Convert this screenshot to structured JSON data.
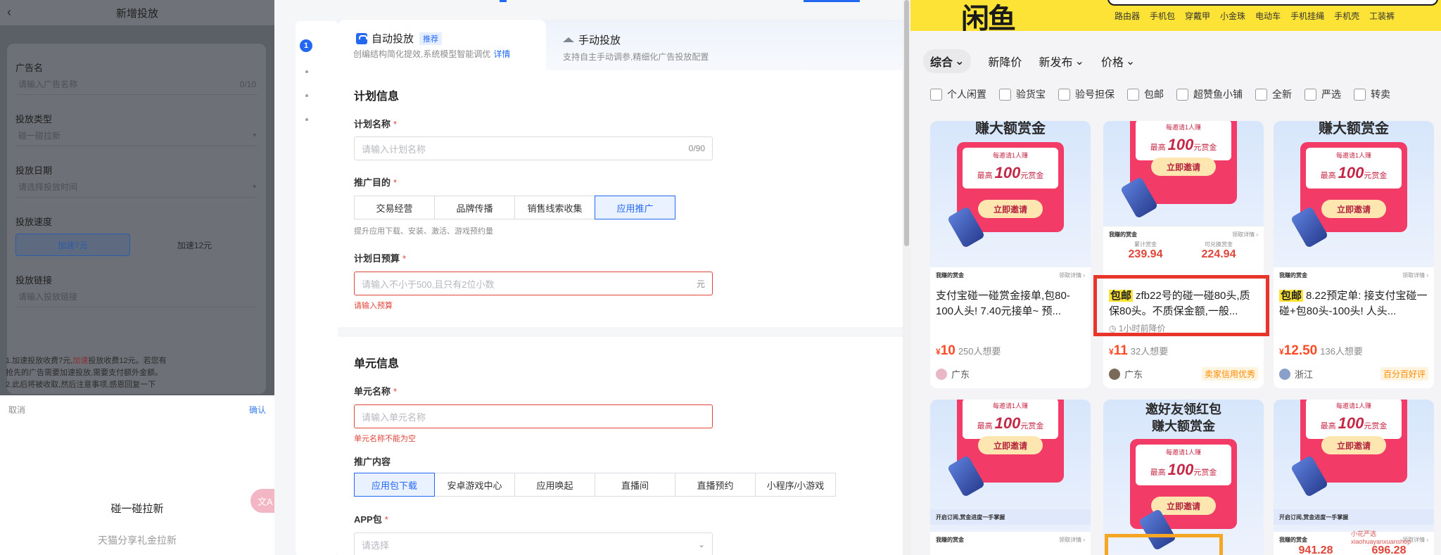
{
  "left": {
    "nav_title": "新增投放",
    "back_icon": "‹",
    "fields": [
      {
        "label": "广告名",
        "placeholder": "请输入广告名称",
        "count": "0/10"
      },
      {
        "label": "投放类型",
        "value": "碰一碰拉新"
      },
      {
        "label": "投放日期",
        "value": "请选择投放时间"
      }
    ],
    "speed_label": "投放速度",
    "speed_options": [
      "加速7元",
      "加速12元"
    ],
    "link_label": "投放链接",
    "link_placeholder": "请输入投放链接",
    "note_line1a": "1.加速投放收费7元,",
    "note_line1b": "加速",
    "note_line1c": "投放收费12元。若您有",
    "note_line1d": "抢先的广告需要加速投放,需要支付额外金额。",
    "note_line2": "2.此后将被收取,然后注意事项,感恩回复一下",
    "sheet_cancel": "取消",
    "sheet_confirm": "确认",
    "picker_selected": "碰一碰拉新",
    "picker_next": "天猫分享礼金拉新",
    "float_label": "文A"
  },
  "form": {
    "step_number": "1",
    "tab_auto": {
      "title": "自动投放",
      "tag": "推荐",
      "desc": "创编结构简化提效,系统模型智能调优",
      "link": "详情"
    },
    "tab_manual": {
      "title": "手动投放",
      "desc": "支持自主手动调参,精细化广告投放配置"
    },
    "plan_section": "计划信息",
    "plan_name_label": "计划名称",
    "plan_name_placeholder": "请输入计划名称",
    "plan_name_count": "0/90",
    "goal_label": "推广目的",
    "goal_options": [
      "交易经营",
      "品牌传播",
      "销售线索收集",
      "应用推广"
    ],
    "goal_hint": "提升应用下载、安装、激活、游戏预约量",
    "budget_label": "计划日预算",
    "budget_placeholder": "请输入不小于500,且只有2位小数",
    "budget_unit": "元",
    "budget_error": "请输入预算",
    "unit_section": "单元信息",
    "unit_name_label": "单元名称",
    "unit_name_placeholder": "请输入单元名称",
    "unit_name_error": "单元名称不能为空",
    "content_label": "推广内容",
    "content_options": [
      "应用包下载",
      "安卓游戏中心",
      "应用唤起",
      "直播间",
      "直播预约",
      "小程序/小游戏"
    ],
    "app_label": "APP包",
    "app_placeholder": "请选择",
    "req_mark": "*"
  },
  "market": {
    "logo_fragment": "闲鱼",
    "hotwords": [
      "路由器",
      "手机包",
      "穿戴甲",
      "小金珠",
      "电动车",
      "手机挂绳",
      "手机壳",
      "工装裤"
    ],
    "sorts": [
      {
        "label": "综合",
        "chev": "⌄",
        "active": true
      },
      {
        "label": "新降价",
        "chev": "",
        "active": false
      },
      {
        "label": "新发布",
        "chev": "⌄",
        "active": false
      },
      {
        "label": "价格",
        "chev": "⌄",
        "active": false
      }
    ],
    "checks": [
      "个人闲置",
      "验货宝",
      "验号担保",
      "包邮",
      "超赞鱼小铺",
      "全新",
      "严选",
      "转卖"
    ],
    "promo": {
      "headline": "赚大额赏金",
      "headline2": "邀好友领红包",
      "invite": "每邀请1人赚",
      "top": "最高",
      "amount": "100",
      "unit": "元赏金",
      "button": "立即邀请",
      "strip_title": "我赚的赏金",
      "strip_more": "领取详情 ›",
      "money1_label": "累计赏金",
      "money1": "239.94",
      "money2_label": "可兑换赏金",
      "money2": "224.94",
      "money_unit": "元",
      "money3": "941.28",
      "money4": "696.28",
      "notice": "开启订阅,赏金进度一手掌握"
    },
    "items": [
      {
        "title": "支付宝碰一碰赏金接单,包80-100人头! 7.40元接单~ 预...",
        "pill": "",
        "price_sym": "¥",
        "price": "10",
        "wants": "250人想要",
        "loc": "广东",
        "badge": ""
      },
      {
        "title": "zfb22号的碰一碰80头,质保80头。不质保金额,一般...",
        "pill": "包邮",
        "price_sym": "¥",
        "price": "11",
        "wants": "32人想要",
        "loc": "广东",
        "badge": "卖家信用优秀",
        "sub": "1小时前降价"
      },
      {
        "title": "8.22预定单: 接支付宝碰一碰+包80头-100头! 人头...",
        "pill": "包邮",
        "price_sym": "¥",
        "price": "12.50",
        "wants": "136人想要",
        "loc": "浙江",
        "badge": "百分百好评"
      }
    ],
    "watermark_name": "小花严选",
    "watermark_sub": "xiaohuayanxuanshop"
  }
}
